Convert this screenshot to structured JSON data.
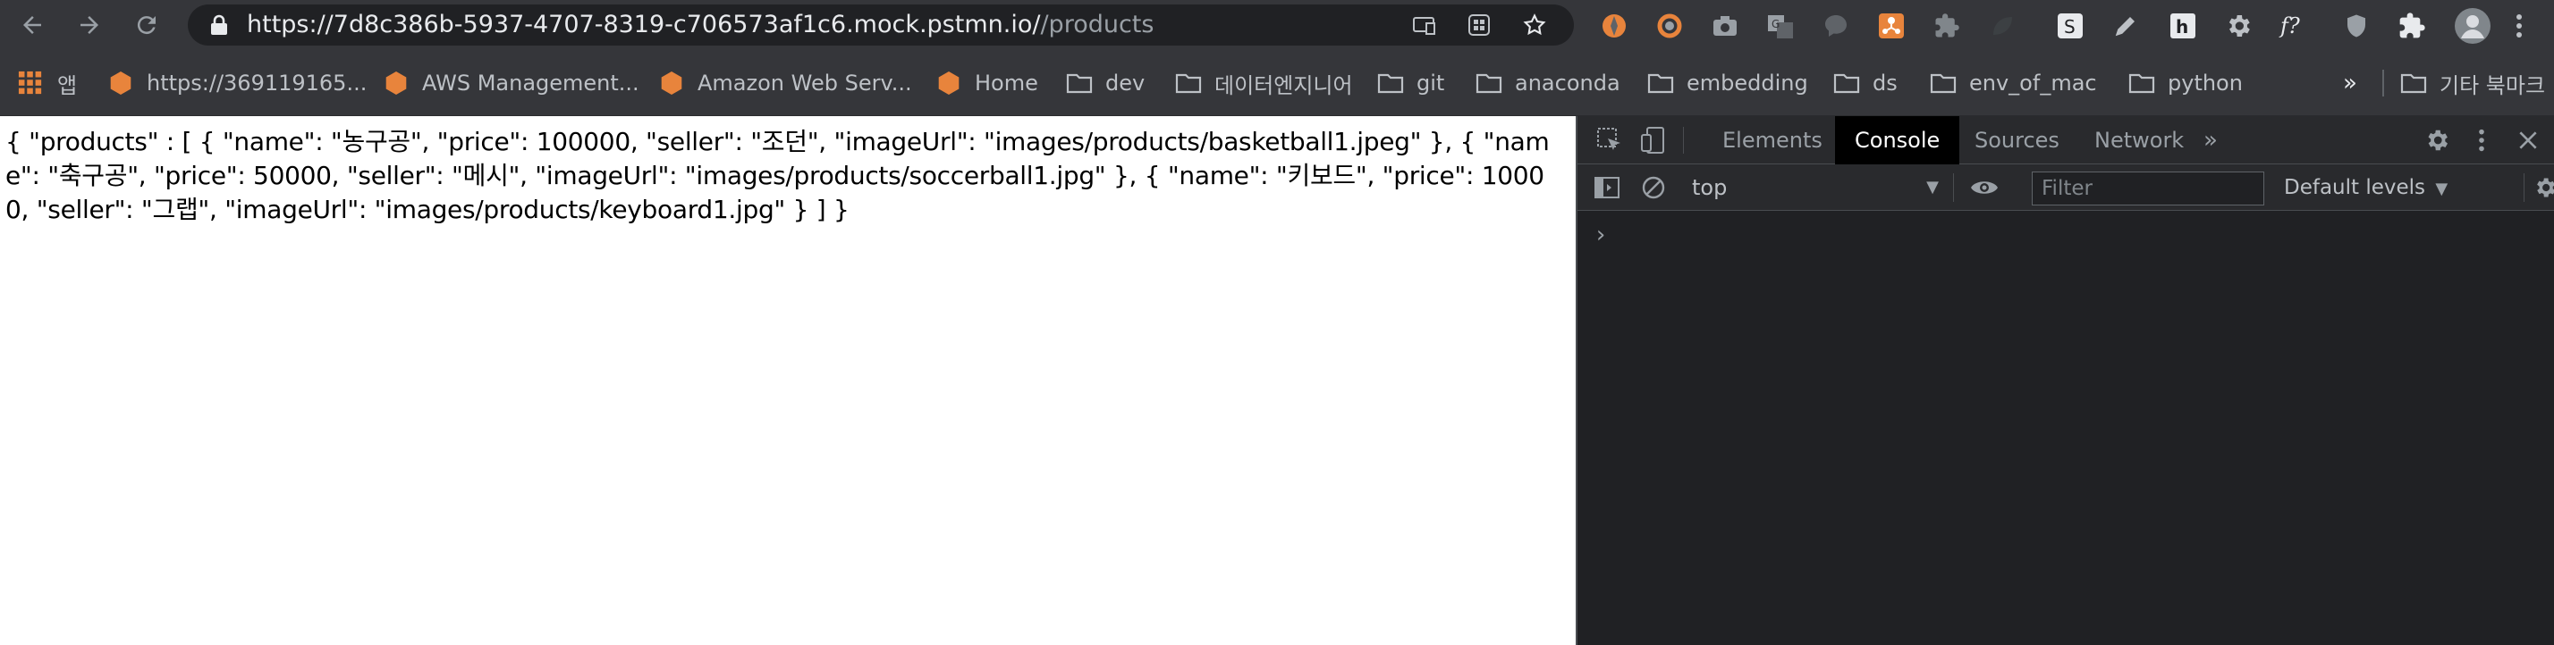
{
  "browser": {
    "url_host": "https://7d8c386b-5937-4707-8319-c706573af1c6.mock.pstmn.io/",
    "url_path": "/products",
    "icons": {
      "back": "back-arrow-icon",
      "forward": "forward-arrow-icon",
      "reload": "reload-icon",
      "lock": "lock-icon",
      "star": "bookmark-star-icon"
    },
    "colors": {
      "toolbar": "#35363a",
      "omnibox": "#202124",
      "text": "#e8eaed",
      "muted": "#9aa0a6",
      "bookmark_hex": "#e8843c"
    }
  },
  "bookmarks": {
    "apps_label": "앱",
    "items": [
      {
        "label": "https://369119165...",
        "icon": "aws-hexagon-icon"
      },
      {
        "label": "AWS Management...",
        "icon": "aws-hexagon-icon"
      },
      {
        "label": "Amazon Web Serv...",
        "icon": "aws-hexagon-icon"
      },
      {
        "label": "Home",
        "icon": "aws-hexagon-icon"
      },
      {
        "label": "dev",
        "icon": "folder-icon"
      },
      {
        "label": "데이터엔지니어",
        "icon": "folder-icon"
      },
      {
        "label": "git",
        "icon": "folder-icon"
      },
      {
        "label": "anaconda",
        "icon": "folder-icon"
      },
      {
        "label": "embedding",
        "icon": "folder-icon"
      },
      {
        "label": "ds",
        "icon": "folder-icon"
      },
      {
        "label": "env_of_mac",
        "icon": "folder-icon"
      },
      {
        "label": "python",
        "icon": "folder-icon"
      }
    ],
    "overflow": "»",
    "other_label": "기타 북마크"
  },
  "page": {
    "json_text": "{ \"products\" : [ { \"name\": \"농구공\", \"price\": 100000, \"seller\": \"조던\", \"imageUrl\": \"images/products/basketball1.jpeg\" }, { \"name\": \"축구공\", \"price\": 50000, \"seller\": \"메시\", \"imageUrl\": \"images/products/soccerball1.jpg\" }, { \"name\": \"키보드\", \"price\": 10000, \"seller\": \"그랩\", \"imageUrl\": \"images/products/keyboard1.jpg\" } ] }"
  },
  "devtools": {
    "tabs": [
      {
        "label": "Elements",
        "active": false
      },
      {
        "label": "Console",
        "active": true
      },
      {
        "label": "Sources",
        "active": false
      },
      {
        "label": "Network",
        "active": false
      }
    ],
    "more_tabs": "»",
    "context": "top",
    "filter_placeholder": "Filter",
    "filter_value": "",
    "levels": "Default levels",
    "prompt": "›",
    "colors": {
      "panel": "#202124",
      "tabbar": "#292a2d",
      "active_tab": "#000000",
      "border": "#494c50"
    }
  }
}
